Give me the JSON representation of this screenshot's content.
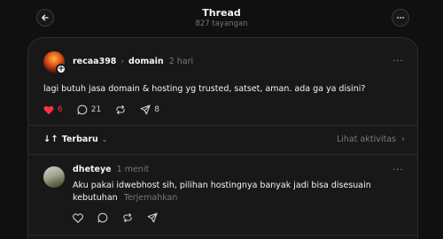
{
  "header": {
    "title": "Thread",
    "subtitle": "827 tayangan"
  },
  "post": {
    "username": "recaa398",
    "topic": "domain",
    "time": "2 hari",
    "text": "lagi butuh jasa domain & hosting yg trusted, satset, aman. ada ga ya disini?",
    "likes": "6",
    "comments": "21",
    "shares": "8",
    "liked": true
  },
  "sort": {
    "label": "Terbaru",
    "activity_label": "Lihat aktivitas"
  },
  "reply": {
    "username": "dheteye",
    "time": "1 menit",
    "text": "Aku pakai idwebhost sih, pilihan hostingnya banyak jadi bisa disesuain kebutuhan",
    "translate_label": "Terjemahkan"
  },
  "colors": {
    "background": "#101010",
    "card": "#181818",
    "like_active": "#ff3040"
  }
}
